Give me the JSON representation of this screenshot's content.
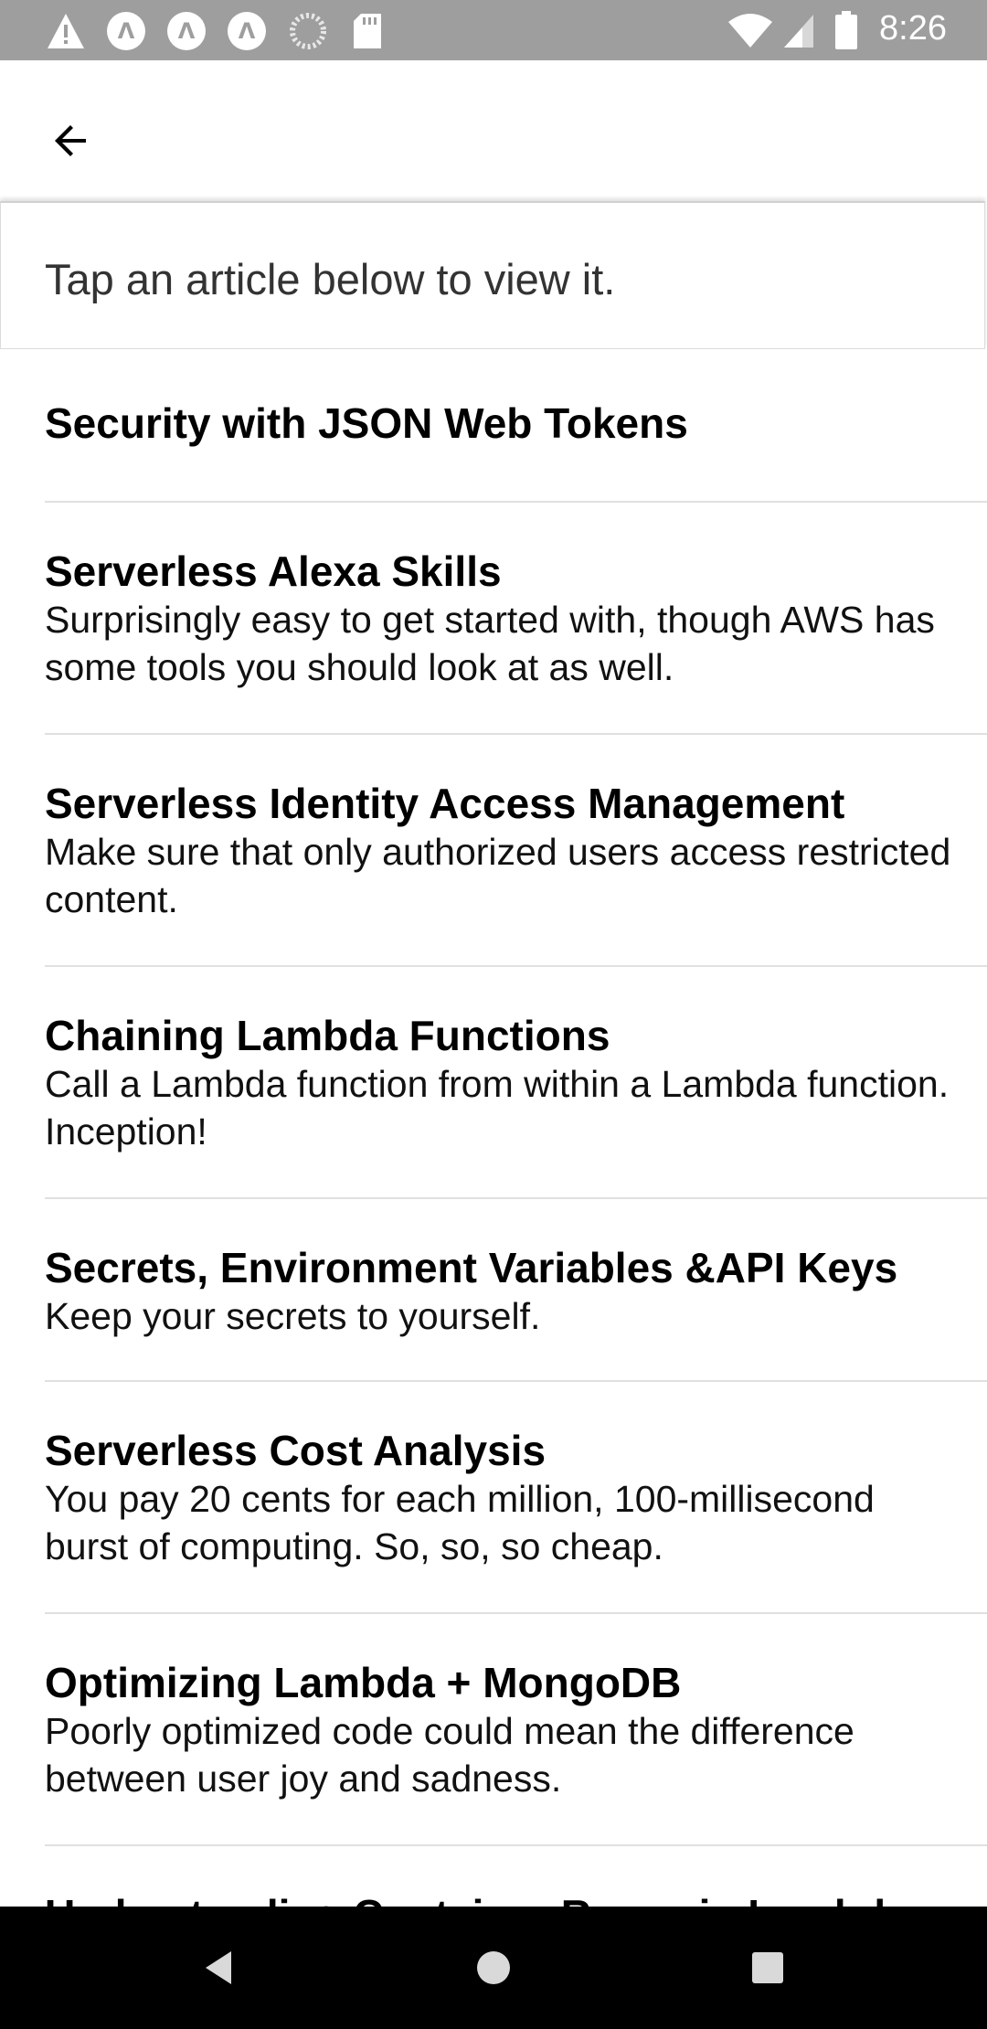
{
  "status_bar": {
    "time": "8:26",
    "left_icons": [
      "warning-icon",
      "app-a-icon",
      "app-a-icon",
      "app-a-icon",
      "loading-icon",
      "sd-card-icon"
    ],
    "right_icons": [
      "wifi-icon",
      "signal-icon",
      "battery-icon"
    ],
    "app_letter": "Λ"
  },
  "header": {
    "back_icon": "arrow-back-icon"
  },
  "hint": {
    "text": "Tap an article below to view it."
  },
  "articles": [
    {
      "title": "Security with JSON Web Tokens",
      "description": ""
    },
    {
      "title": "Serverless Alexa Skills",
      "description": "Surprisingly easy to get started with, though AWS has some tools you should look at as well."
    },
    {
      "title": "Serverless Identity Access Management",
      "description": "Make sure that only authorized users access restricted content."
    },
    {
      "title": "Chaining Lambda Functions",
      "description": "Call a Lambda function from within a Lambda function. Inception!"
    },
    {
      "title": "Secrets, Environment Variables &API Keys",
      "description": "Keep your secrets to yourself."
    },
    {
      "title": "Serverless Cost Analysis",
      "description": "You pay 20 cents for each million, 100-millisecond burst of computing. So, so, so cheap."
    },
    {
      "title": "Optimizing Lambda + MongoDB",
      "description": "Poorly optimized code could mean the difference between user joy and sadness."
    },
    {
      "title": "Understanding Container Reuse in Lambda",
      "description": ""
    }
  ],
  "nav_bar": {
    "icons": [
      "back-triangle-icon",
      "home-circle-icon",
      "recents-square-icon"
    ]
  },
  "colors": {
    "status_bar_bg": "#9e9e9e",
    "nav_bar_bg": "#000000",
    "divider": "#e0e0e0"
  }
}
